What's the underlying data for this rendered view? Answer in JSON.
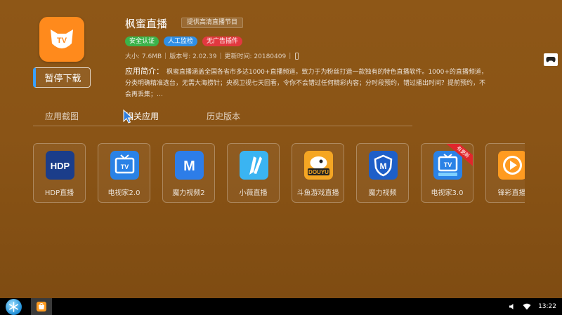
{
  "app": {
    "title": "枫蜜直播",
    "tagline": "提供高清直播节目",
    "badges": [
      {
        "label": "安全认证",
        "color": "#3bb34a"
      },
      {
        "label": "人工监检",
        "color": "#2f8fe6"
      },
      {
        "label": "无广告插件",
        "color": "#e2383f"
      }
    ],
    "meta": {
      "size": "大小: 7.6MB",
      "version": "版本号: 2.02.39",
      "updated": "更新时间: 20180409"
    },
    "description_label": "应用简介：",
    "description": "枫蜜直播涵盖全国各省市多达1000+直播频道，致力于为粉丝打造一款独有的特色直播软件。1000+的直播频道，分类明确精准选台，无需大海捞针；央视卫视七天回看，令你不会错过任何精彩内容；分时段预约，错过播出时间？提前预约，不会再丢集；…",
    "action_button": "暂停下载",
    "icon_color": "#ff8a1c"
  },
  "tabs": [
    {
      "label": "应用截图",
      "active": false
    },
    {
      "label": "相关应用",
      "active": true
    },
    {
      "label": "历史版本",
      "active": false
    }
  ],
  "related_apps": [
    {
      "name": "HDP直播",
      "icon": "hdp-icon",
      "color": "#1b3d8a"
    },
    {
      "name": "电视家2.0",
      "icon": "tv-icon",
      "color": "#2a82e6"
    },
    {
      "name": "魔力视频2",
      "icon": "m-letter-icon",
      "color": "#2d7de8"
    },
    {
      "name": "小薇直播",
      "icon": "rabbit-icon",
      "color": "#3ab4f2"
    },
    {
      "name": "斗鱼游戏直播",
      "icon": "douyu-icon",
      "color": "#f5a623"
    },
    {
      "name": "魔力视频",
      "icon": "m-shield-icon",
      "color": "#1e5fc8"
    },
    {
      "name": "电视家3.0",
      "icon": "tv-icon",
      "color": "#2a82e6",
      "ribbon": "有更新"
    },
    {
      "name": "锋彩直播",
      "icon": "play-icon",
      "color": "#ff9b20"
    }
  ],
  "taskbar": {
    "clock": "13:22"
  }
}
